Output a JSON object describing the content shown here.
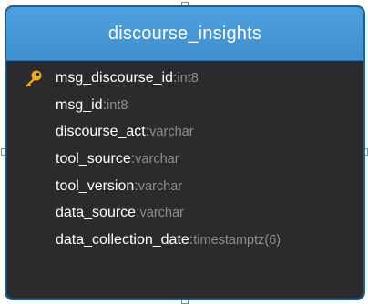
{
  "table": {
    "title": "discourse_insights",
    "columns": [
      {
        "name": "msg_discourse_id",
        "separator": ":",
        "type": " int8",
        "primary_key": true,
        "icon": "key-icon"
      },
      {
        "name": "msg_id",
        "separator": ":",
        "type": " int8",
        "primary_key": false
      },
      {
        "name": "discourse_act",
        "separator": ":",
        "type": " varchar",
        "primary_key": false
      },
      {
        "name": "tool_source",
        "separator": ":",
        "type": " varchar",
        "primary_key": false
      },
      {
        "name": "tool_version",
        "separator": ":",
        "type": " varchar",
        "primary_key": false
      },
      {
        "name": "data_source",
        "separator": ":",
        "type": " varchar",
        "primary_key": false
      },
      {
        "name": "data_collection_date",
        "separator": ":",
        "type": " timestamptz(6)",
        "primary_key": false
      }
    ]
  },
  "colors": {
    "header": "#4a9bd9",
    "border": "#1d5e96",
    "body": "#2b2b2d",
    "key": "#f0a81e"
  }
}
